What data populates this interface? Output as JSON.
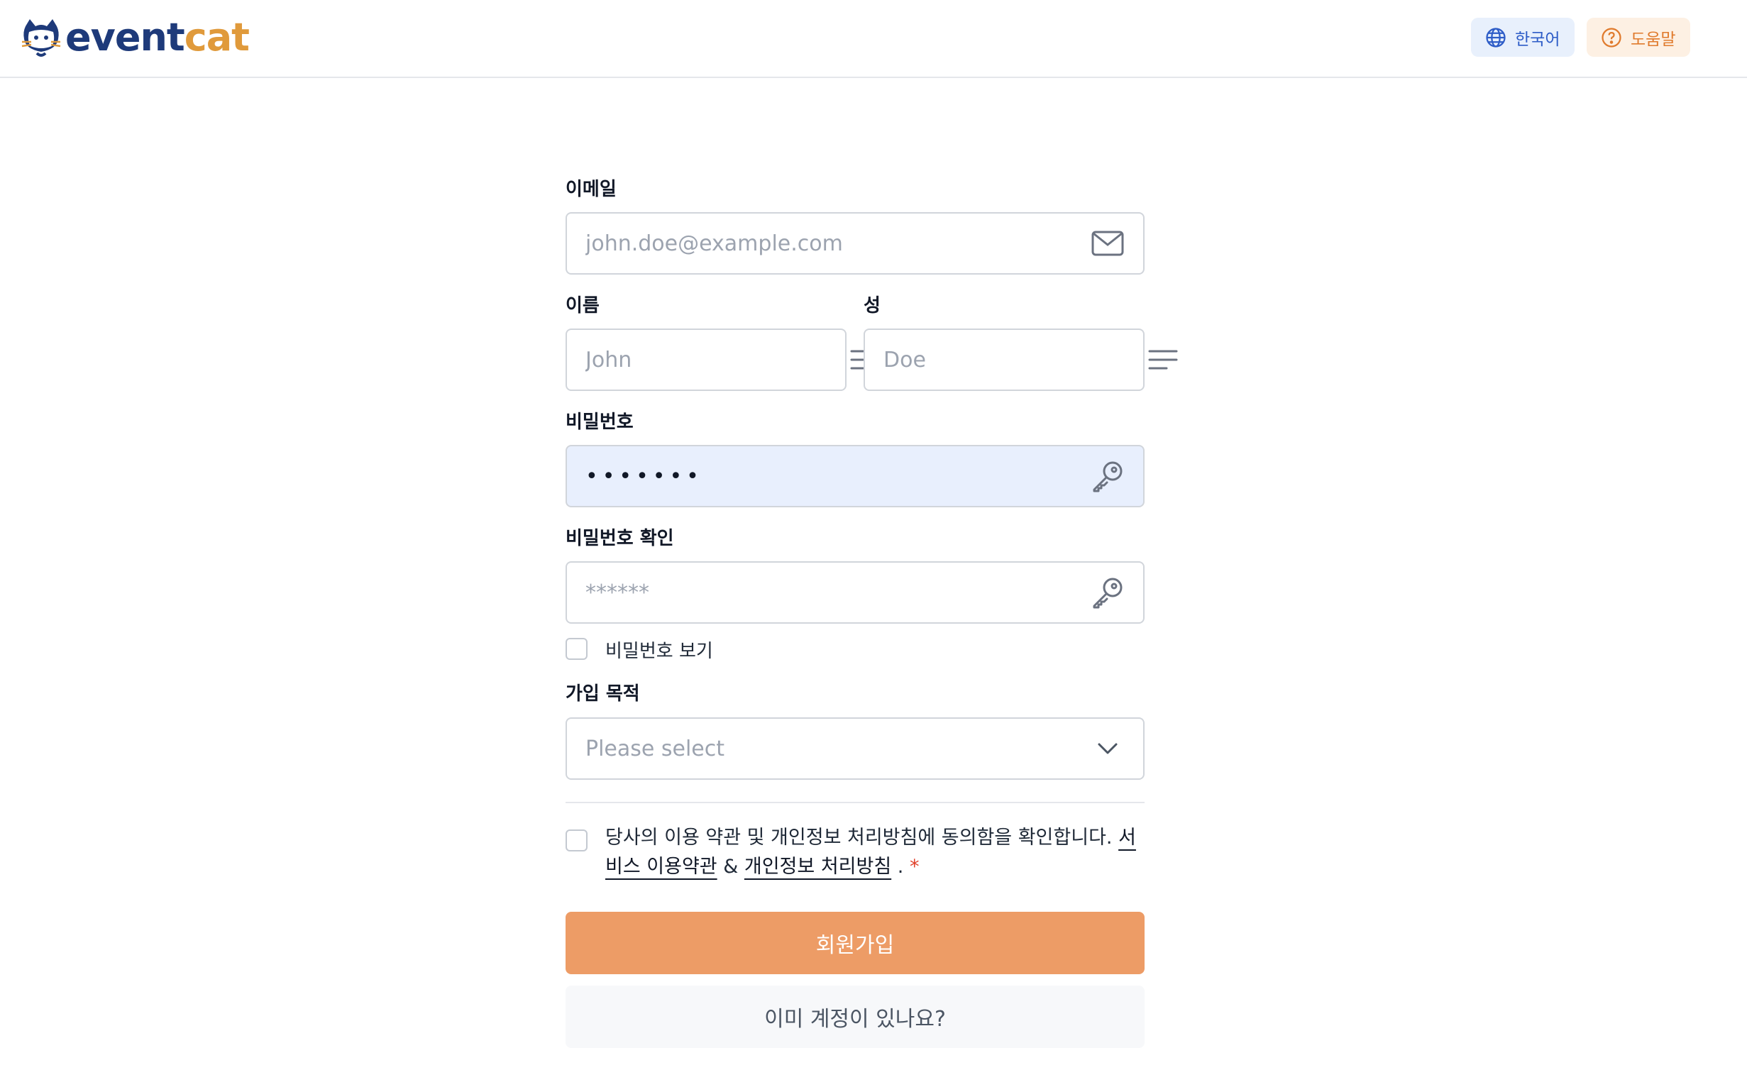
{
  "header": {
    "logo_part1": "event",
    "logo_part2": "cat",
    "language_label": "한국어",
    "help_label": "도움말"
  },
  "form": {
    "email": {
      "label": "이메일",
      "placeholder": "john.doe@example.com",
      "icon": "mail-icon"
    },
    "first_name": {
      "label": "이름",
      "placeholder": "John",
      "icon": "text-lines-icon"
    },
    "last_name": {
      "label": "성",
      "placeholder": "Doe",
      "icon": "text-lines-icon"
    },
    "password": {
      "label": "비밀번호",
      "value": "•••••••",
      "icon": "key-icon"
    },
    "password_confirm": {
      "label": "비밀번호 확인",
      "placeholder": "******",
      "icon": "key-icon"
    },
    "show_password_label": "비밀번호 보기",
    "purpose": {
      "label": "가입 목적",
      "placeholder": "Please select",
      "icon": "chevron-down-icon"
    },
    "terms": {
      "text": "당사의 이용 약관 및 개인정보 처리방침에 동의함을 확인합니다.",
      "service_terms_link": "서비스 이용약관",
      "ampersand": "&",
      "privacy_link": "개인정보 처리방침",
      "period": ".",
      "required_mark": "*"
    },
    "submit_label": "회원가입",
    "login_label": "이미 계정이 있나요?"
  },
  "colors": {
    "primary_button": "#ed9c66",
    "brand_dark": "#1e3a7a",
    "brand_accent": "#e09a3b"
  }
}
